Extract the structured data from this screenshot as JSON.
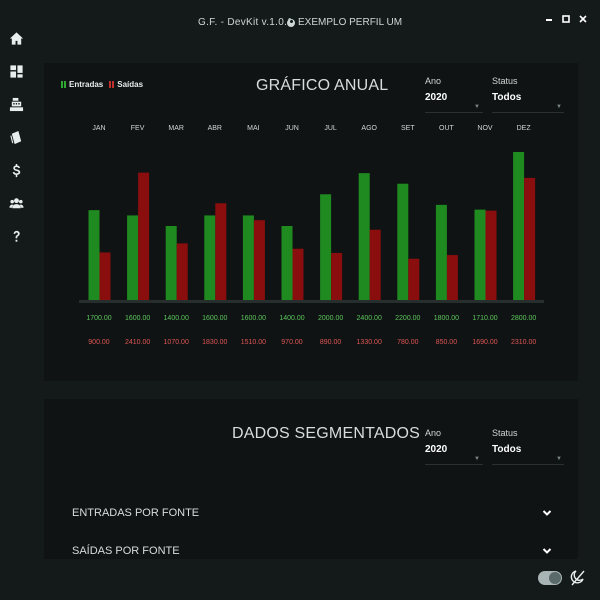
{
  "window": {
    "title": "G.F. - DevKit v.1.0.1",
    "profile_name": "EXEMPLO PERFIL UM"
  },
  "sidebar": {
    "items": [
      {
        "id": "home",
        "icon": "home-icon"
      },
      {
        "id": "dashboard",
        "icon": "dashboard-grid-icon"
      },
      {
        "id": "cash-register",
        "icon": "cash-register-icon"
      },
      {
        "id": "receipts",
        "icon": "receipt-icon"
      },
      {
        "id": "finance",
        "icon": "dollar-icon"
      },
      {
        "id": "users",
        "icon": "users-icon"
      },
      {
        "id": "help",
        "icon": "help-icon"
      }
    ]
  },
  "annual": {
    "title": "GRÁFICO ANUAL",
    "legend": {
      "entradas": "Entradas",
      "saidas": "Saídas"
    },
    "year": {
      "label": "Ano",
      "value": "2020"
    },
    "status": {
      "label": "Status",
      "value": "Todos"
    }
  },
  "chart_data": {
    "type": "bar",
    "title": "GRÁFICO ANUAL",
    "categories": [
      "JAN",
      "FEV",
      "MAR",
      "ABR",
      "MAI",
      "JUN",
      "JUL",
      "AGO",
      "SET",
      "OUT",
      "NOV",
      "DEZ"
    ],
    "series": [
      {
        "name": "Entradas",
        "color": "#1f8a1f",
        "label_color": "#5cc65c",
        "values": [
          1700,
          1600,
          1400,
          1600,
          1600,
          1400,
          2000,
          2400,
          2200,
          1800,
          1710,
          2800
        ],
        "labels": [
          "1700.00",
          "1600.00",
          "1400.00",
          "1600.00",
          "1600.00",
          "1400.00",
          "2000.00",
          "2400.00",
          "2200.00",
          "1800.00",
          "1710.00",
          "2800.00"
        ]
      },
      {
        "name": "Saídas",
        "color": "#8b0e0e",
        "label_color": "#e05555",
        "values": [
          900,
          2410,
          1070,
          1830,
          1510,
          970,
          890,
          1330,
          780,
          850,
          1690,
          2310
        ],
        "labels": [
          "900.00",
          "2410.00",
          "1070.00",
          "1830.00",
          "1510.00",
          "970.00",
          "890.00",
          "1330.00",
          "780.00",
          "850.00",
          "1690.00",
          "2310.00"
        ]
      }
    ],
    "ylim": [
      0,
      2800
    ],
    "grid": false,
    "legend_position": "top-left"
  },
  "segmented": {
    "title": "DADOS SEGMENTADOS",
    "year": {
      "label": "Ano",
      "value": "2020"
    },
    "status": {
      "label": "Status",
      "value": "Todos"
    },
    "rows": [
      {
        "label": "ENTRADAS POR FONTE"
      },
      {
        "label": "SAÍDAS POR FONTE"
      }
    ]
  },
  "colors": {
    "background": "#141a1a",
    "card": "#0f1313",
    "entradas": "#1f8a1f",
    "saidas": "#8b0e0e"
  }
}
